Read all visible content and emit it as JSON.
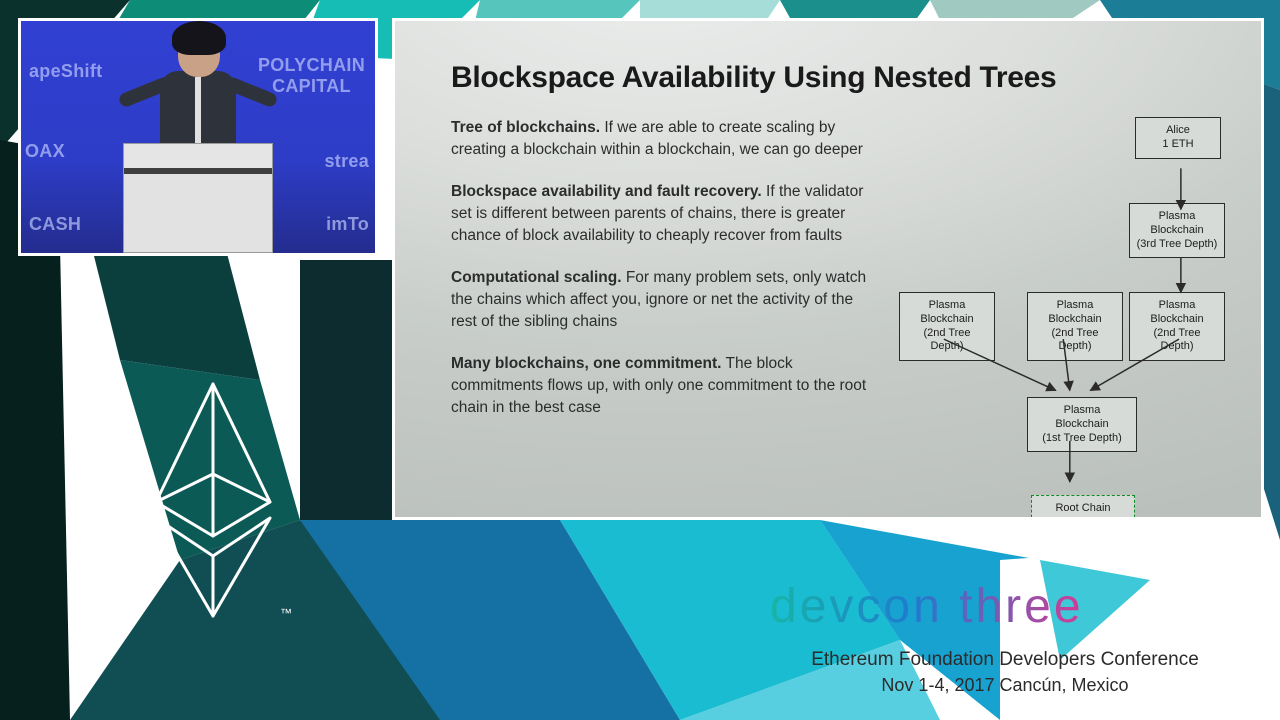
{
  "pip": {
    "sponsors": {
      "polychain": "POLYCHAIN\nCAPITAL",
      "shapeshift": "apeShift",
      "oax": "OAX",
      "streamr": "strea",
      "cash": "CASH",
      "imtoken": "imTo"
    }
  },
  "slide": {
    "title": "Blockspace Availability Using Nested Trees",
    "p1_b": "Tree of blockchains.",
    "p1": " If we are able to create scaling by creating a blockchain within a blockchain, we can go deeper",
    "p2_b": "Blockspace availability and fault recovery.",
    "p2": " If the validator set is different between parents of chains, there is greater chance of block availability to cheaply recover from faults",
    "p3_b": "Computational scaling.",
    "p3": " For many problem sets, only watch the chains which affect you, ignore or net the activity of the rest of the sibling chains",
    "p4_b": "Many blockchains, one commitment.",
    "p4": " The block commitments flows up, with only one commitment to the root chain in the best case",
    "diagram": {
      "alice": "Alice\n1 ETH",
      "l3": "Plasma\nBlockchain\n(3rd Tree Depth)",
      "l2a": "Plasma\nBlockchain\n(2nd Tree Depth)",
      "l2b": "Plasma\nBlockchain\n(2nd Tree Depth)",
      "l2c": "Plasma\nBlockchain\n(2nd Tree Depth)",
      "l1": "Plasma\nBlockchain\n(1st Tree Depth)",
      "root": "Root Chain\n(e.g. Ethereum)"
    }
  },
  "event": {
    "logo_text": "devcon three",
    "subtitle": "Ethereum Foundation Developers Conference",
    "dateline": "Nov 1-4, 2017   Cancún, Mexico"
  },
  "logo": {
    "tm": "™"
  }
}
